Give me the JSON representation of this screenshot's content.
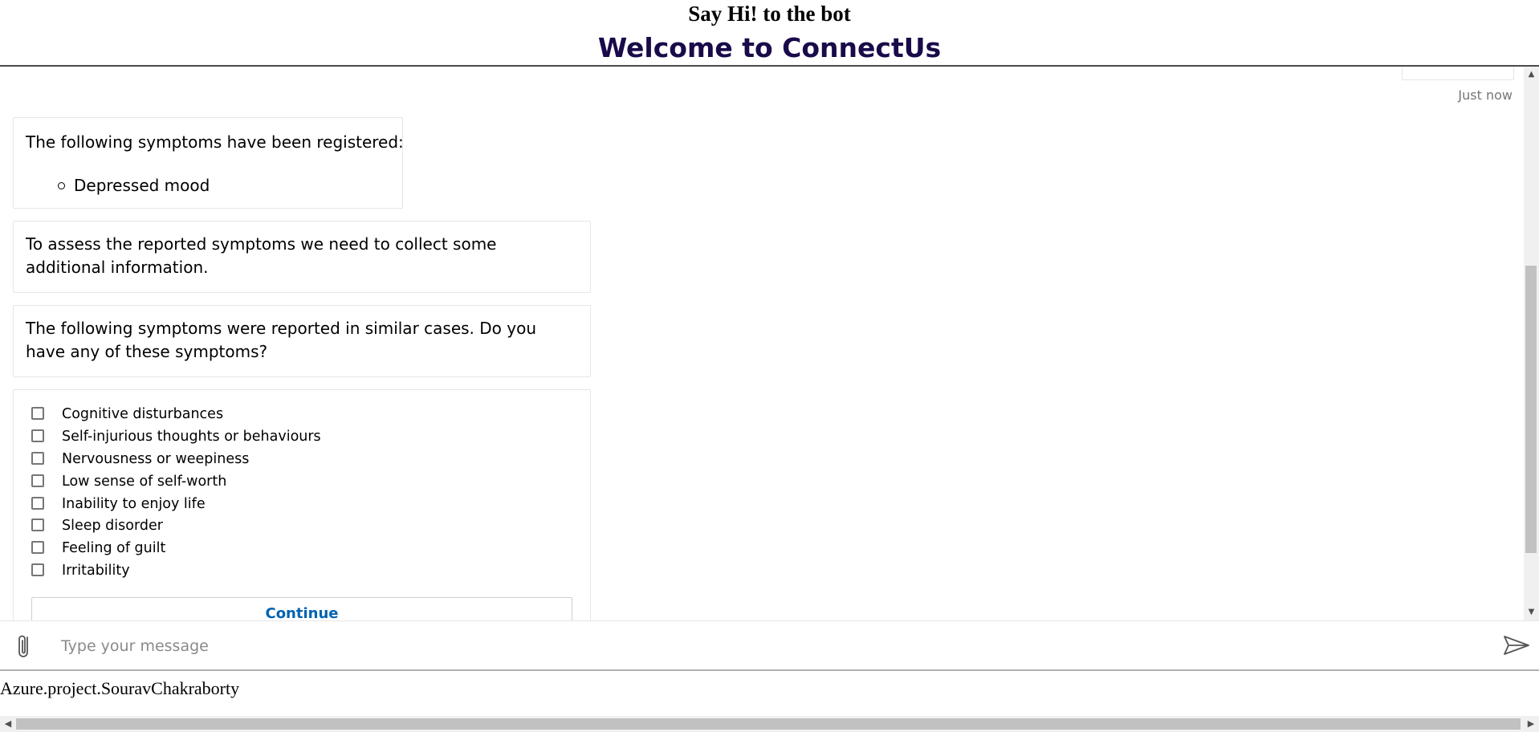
{
  "header": {
    "title": "Say Hi! to the bot",
    "welcome": "Welcome to ConnectUs"
  },
  "transcript": {
    "timestamp": "Just now",
    "messages": {
      "registered": {
        "text": "The following symptoms have been registered:",
        "items": [
          "Depressed mood"
        ]
      },
      "assess": "To assess the reported symptoms we need to collect some additional information.",
      "similar": "The following symptoms were reported in similar cases. Do you have any of these symptoms?"
    },
    "card": {
      "options": [
        {
          "label": "Cognitive disturbances",
          "checked": false
        },
        {
          "label": "Self-injurious thoughts or behaviours",
          "checked": false
        },
        {
          "label": "Nervousness or weepiness",
          "checked": false
        },
        {
          "label": "Low sense of self-worth",
          "checked": false
        },
        {
          "label": "Inability to enjoy life",
          "checked": false
        },
        {
          "label": "Sleep disorder",
          "checked": false
        },
        {
          "label": "Feeling of guilt",
          "checked": false
        },
        {
          "label": "Irritability",
          "checked": false
        }
      ],
      "continue_label": "Continue"
    }
  },
  "input": {
    "placeholder": "Type your message",
    "value": "",
    "attach_icon": "paperclip-icon",
    "send_icon": "send-icon"
  },
  "footer": {
    "text": "Azure.project.SouravChakraborty"
  },
  "colors": {
    "welcome": "#1a0a4a",
    "button_text": "#0063b1",
    "bubble_border": "#e6e6e6"
  }
}
